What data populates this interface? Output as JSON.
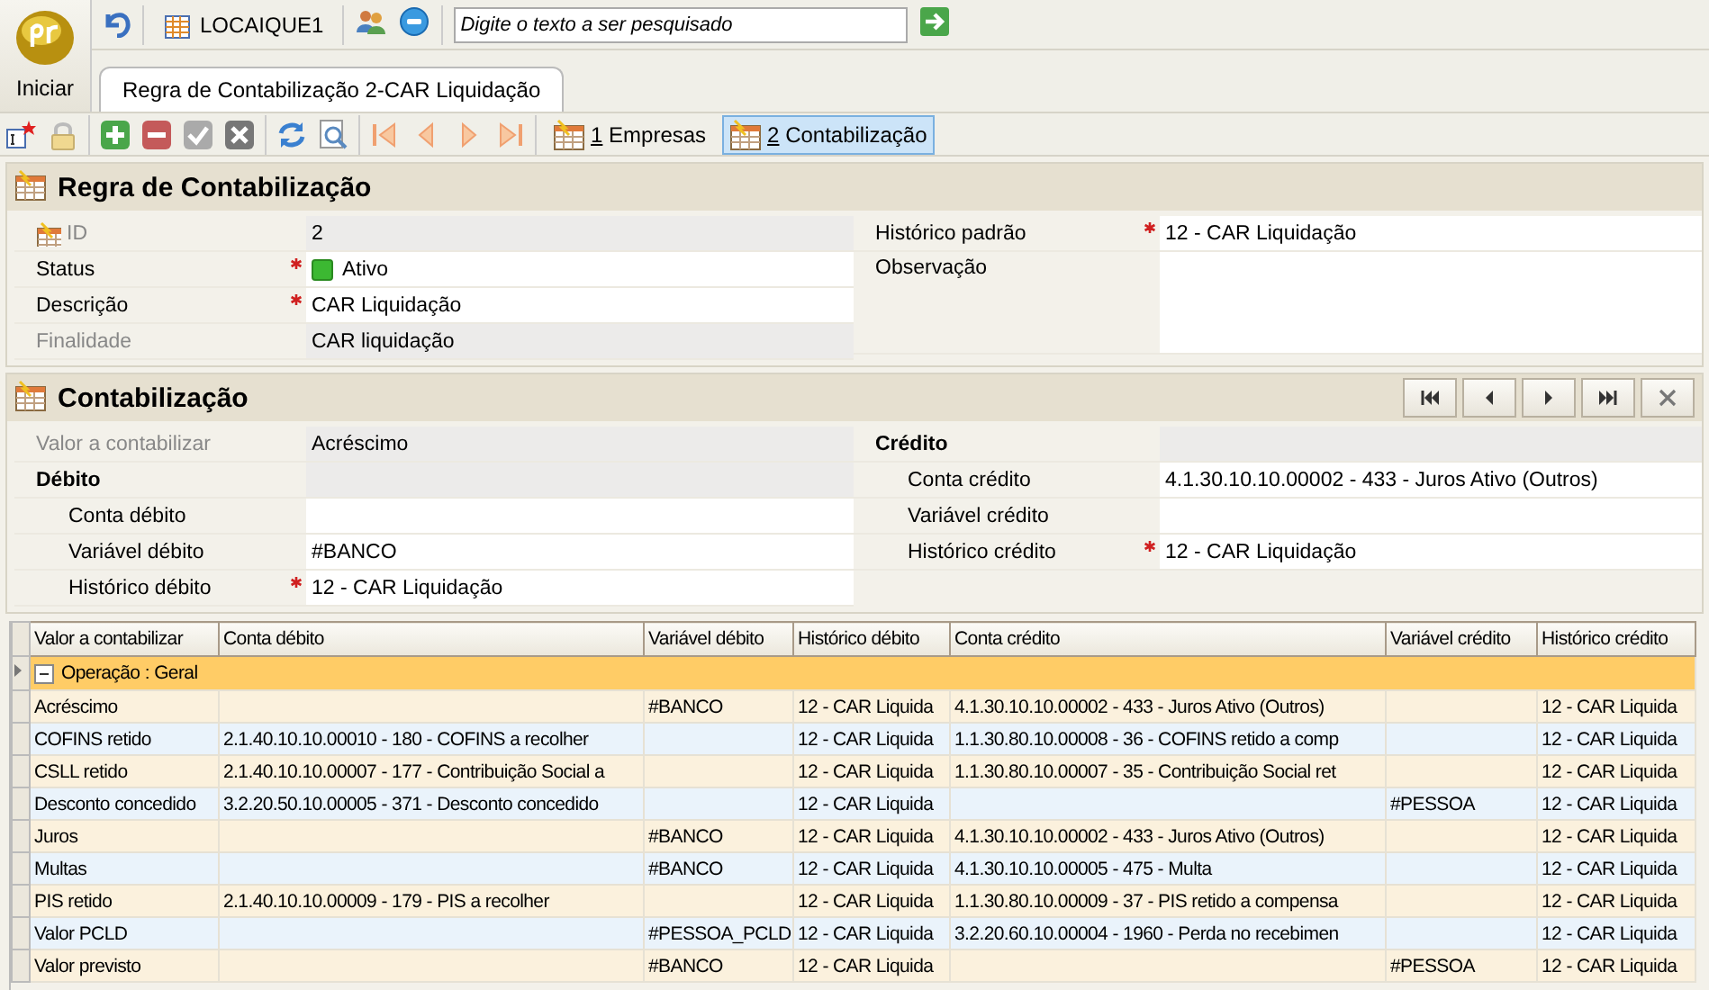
{
  "app": {
    "start_label": "Iniciar",
    "workspace": "LOCAIQUE1",
    "search_placeholder": "Digite o texto a ser pesquisado"
  },
  "document_tabs": [
    {
      "label": "Regra de Contabilização 2-CAR Liquidação",
      "selected": true
    }
  ],
  "views": [
    {
      "key": "1",
      "label": "Empresas",
      "selected": false
    },
    {
      "key": "2",
      "label": "Contabilização",
      "selected": true
    }
  ],
  "rule_section": {
    "title": "Regra de Contabilização",
    "left_fields": [
      {
        "kind": "id",
        "label": "ID",
        "value": "2",
        "required": false,
        "readonly": true
      },
      {
        "kind": "status",
        "label": "Status",
        "value": "Ativo",
        "required": true,
        "readonly": false
      },
      {
        "kind": "text",
        "label": "Descrição",
        "value": "CAR Liquidação",
        "required": true,
        "readonly": false
      },
      {
        "kind": "text",
        "label": "Finalidade",
        "value": "CAR liquidação",
        "required": false,
        "readonly": true
      }
    ],
    "right_fields": [
      {
        "kind": "text",
        "label": "Histórico padrão",
        "value": "12 - CAR Liquidação",
        "required": true,
        "readonly": false
      },
      {
        "kind": "memo",
        "label": "Observação",
        "required": false,
        "readonly": false
      }
    ]
  },
  "posting_section": {
    "title": "Contabilização",
    "left_fields": [
      {
        "kind": "text",
        "label": "Valor a contabilizar",
        "value": "Acréscimo",
        "required": false,
        "readonly": true
      },
      {
        "kind": "group",
        "label": "Débito"
      },
      {
        "kind": "sub",
        "label": "Conta débito",
        "required": false,
        "readonly": false
      },
      {
        "kind": "sub",
        "label": "Variável débito",
        "value": "#BANCO",
        "required": false,
        "readonly": false
      },
      {
        "kind": "sub",
        "label": "Histórico débito",
        "value": "12 - CAR Liquidação",
        "required": true,
        "readonly": false
      }
    ],
    "right_fields": [
      {
        "kind": "group",
        "label": "Crédito"
      },
      {
        "kind": "sub",
        "label": "Conta crédito",
        "value": "4.1.30.10.10.00002 - 433 - Juros Ativo (Outros)",
        "required": false,
        "readonly": false
      },
      {
        "kind": "sub",
        "label": "Variável crédito",
        "required": false,
        "readonly": false
      },
      {
        "kind": "sub",
        "label": "Histórico crédito",
        "value": "12 - CAR Liquidação",
        "required": true,
        "readonly": false
      }
    ]
  },
  "table": {
    "columns": [
      "Valor a contabilizar",
      "Conta débito",
      "Variável débito",
      "Histórico débito",
      "Conta crédito",
      "Variável crédito",
      "Histórico crédito"
    ],
    "group": {
      "label": "Operação : Geral",
      "expanded": true
    },
    "rows": [
      [
        "Acréscimo",
        "",
        "#BANCO",
        "12 - CAR Liquida",
        "4.1.30.10.10.00002 - 433 - Juros Ativo (Outros)",
        "",
        "12 - CAR Liquida"
      ],
      [
        "COFINS retido",
        "2.1.40.10.10.00010 - 180 - COFINS a recolher",
        "",
        "12 - CAR Liquida",
        "1.1.30.80.10.00008 - 36 - COFINS retido a comp",
        "",
        "12 - CAR Liquida"
      ],
      [
        "CSLL retido",
        "2.1.40.10.10.00007 - 177 - Contribuição Social a",
        "",
        "12 - CAR Liquida",
        "1.1.30.80.10.00007 - 35 - Contribuição Social ret",
        "",
        "12 - CAR Liquida"
      ],
      [
        "Desconto concedido",
        "3.2.20.50.10.00005 - 371 - Desconto concedido",
        "",
        "12 - CAR Liquida",
        "",
        "#PESSOA",
        "12 - CAR Liquida"
      ],
      [
        "Juros",
        "",
        "#BANCO",
        "12 - CAR Liquida",
        "4.1.30.10.10.00002 - 433 - Juros Ativo (Outros)",
        "",
        "12 - CAR Liquida"
      ],
      [
        "Multas",
        "",
        "#BANCO",
        "12 - CAR Liquida",
        "4.1.30.10.10.00005 - 475 - Multa",
        "",
        "12 - CAR Liquida"
      ],
      [
        "PIS retido",
        "2.1.40.10.10.00009 - 179 - PIS a recolher",
        "",
        "12 - CAR Liquida",
        "1.1.30.80.10.00009 - 37 - PIS retido a compensa",
        "",
        "12 - CAR Liquida"
      ],
      [
        "Valor PCLD",
        "",
        "#PESSOA_PCLD",
        "12 - CAR Liquida",
        "3.2.20.60.10.00004 - 1960 - Perda no recebimen",
        "",
        "12 - CAR Liquida"
      ],
      [
        "Valor previsto",
        "",
        "#BANCO",
        "12 - CAR Liquida",
        "",
        "#PESSOA",
        "12 - CAR Liquida"
      ]
    ]
  }
}
